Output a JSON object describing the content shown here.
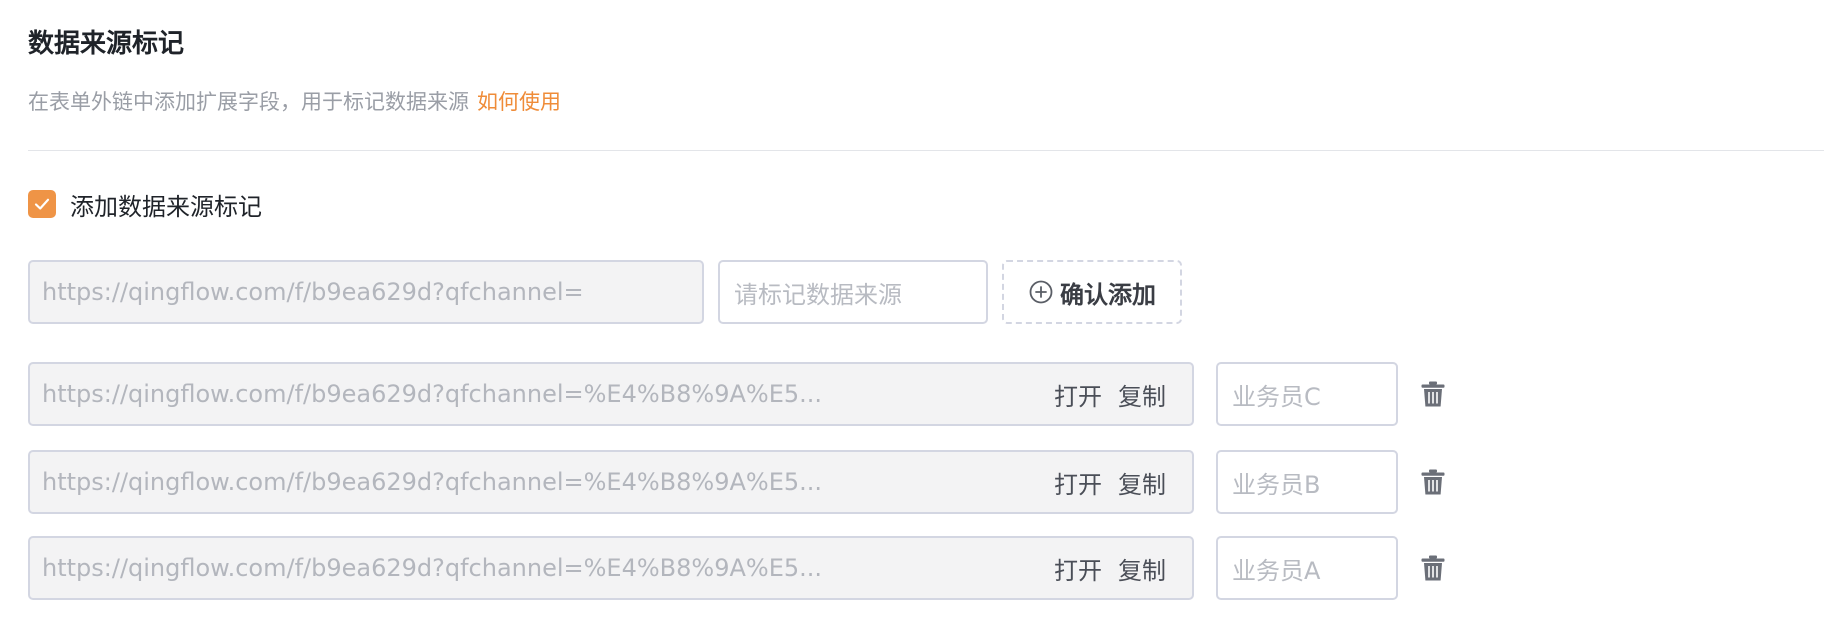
{
  "section": {
    "title": "数据来源标记",
    "description": "在表单外链中添加扩展字段，用于标记数据来源",
    "help_link": "如何使用"
  },
  "toggle": {
    "label": "添加数据来源标记",
    "checked": true,
    "accent_color": "#ef9446"
  },
  "new_entry": {
    "base_url": "https://qingflow.com/f/b9ea629d?qfchannel=",
    "source_placeholder": "请标记数据来源",
    "confirm_label": "确认添加"
  },
  "entries": [
    {
      "url": "https://qingflow.com/f/b9ea629d?qfchannel=%E4%B8%9A%E5...",
      "open_label": "打开",
      "copy_label": "复制",
      "source": "业务员C"
    },
    {
      "url": "https://qingflow.com/f/b9ea629d?qfchannel=%E4%B8%9A%E5...",
      "open_label": "打开",
      "copy_label": "复制",
      "source": "业务员B"
    },
    {
      "url": "https://qingflow.com/f/b9ea629d?qfchannel=%E4%B8%9A%E5...",
      "open_label": "打开",
      "copy_label": "复制",
      "source": "业务员A"
    }
  ],
  "icons": {
    "check": "check-icon",
    "add": "plus-circle-icon",
    "delete": "trash-icon"
  },
  "colors": {
    "link": "#ef8c39",
    "accent": "#ef9446"
  }
}
